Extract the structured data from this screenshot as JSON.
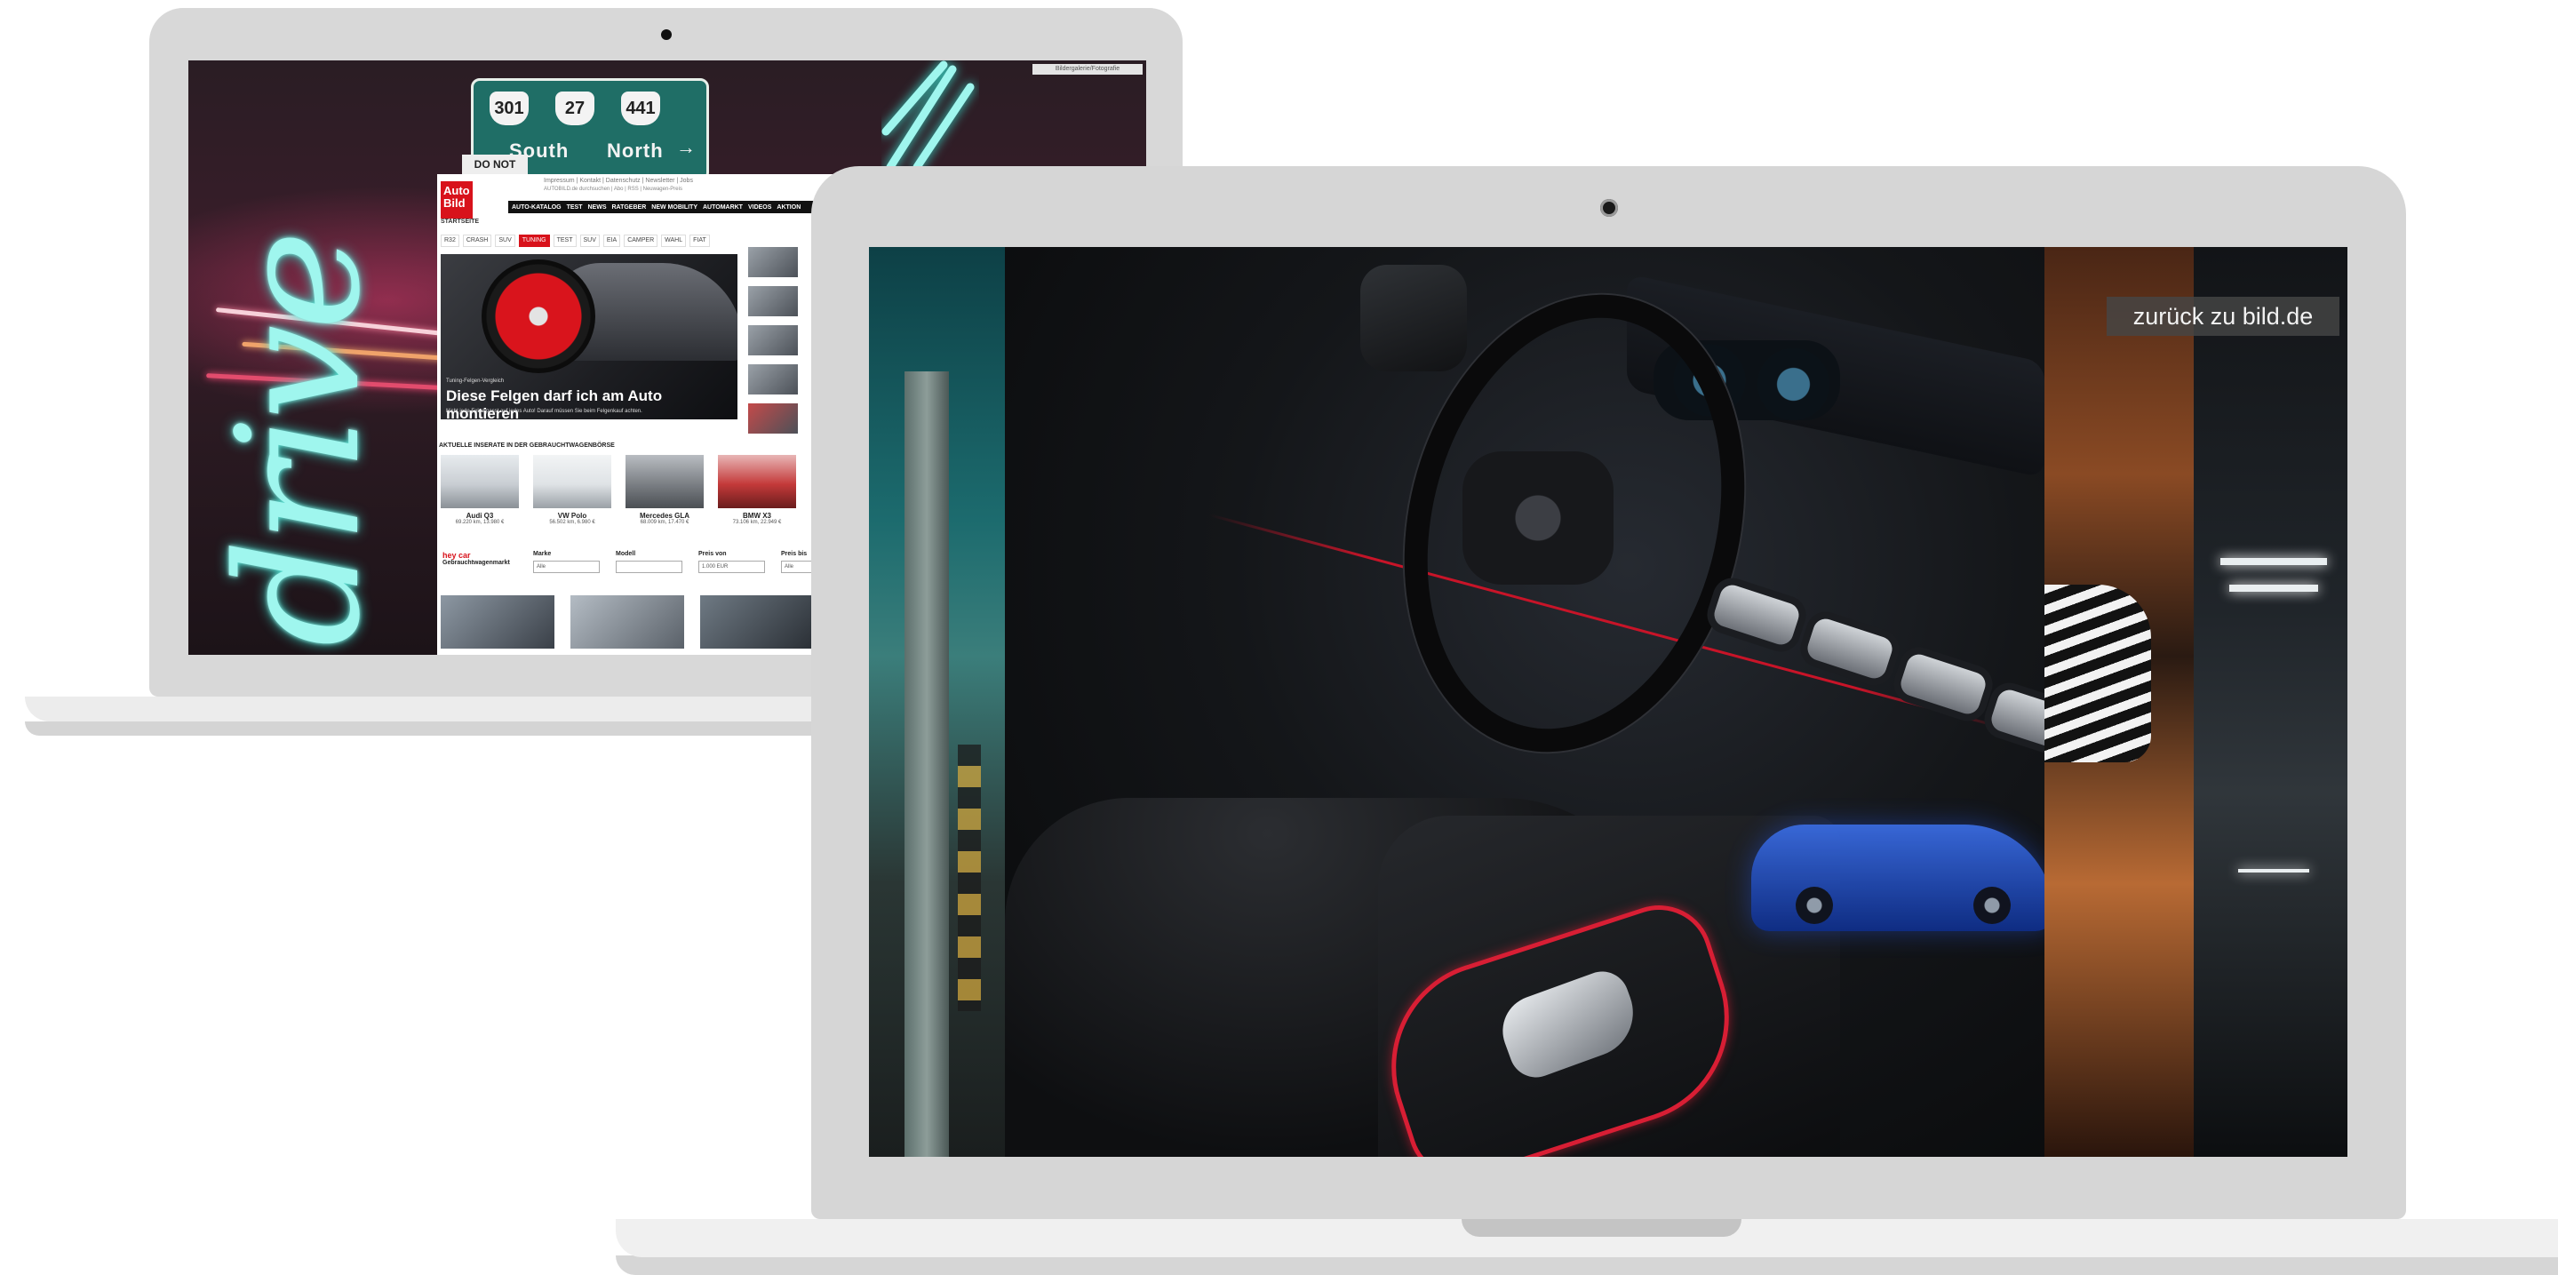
{
  "back_laptop": {
    "scene": {
      "neon_text": "drive",
      "highway_sign": {
        "routes": [
          "301",
          "27",
          "441"
        ],
        "direction_left": "South",
        "direction_right": "North",
        "arrow": "→",
        "extra": "DO NOT"
      },
      "corner_tag": "Bildergalerie/Fotografie"
    },
    "autobild": {
      "logo_line1": "Auto",
      "logo_line2": "Bild",
      "top_links": "Impressum | Kontakt | Datenschutz | Newsletter | Jobs",
      "search_text": "AUTOBILD.de durchsuchen | Abo | RSS | Neuwagen-Preis",
      "nav": [
        "AUTO-KATALOG",
        "TEST",
        "NEWS",
        "RATGEBER",
        "NEW MOBILITY",
        "AUTOMARKT",
        "VIDEOS",
        "AKTION"
      ],
      "breadcrumb": "STARTSEITE",
      "tabs": [
        "R32",
        "CRASH",
        "SUV",
        "TUNING",
        "TEST",
        "SUV",
        "EIA",
        "CAMPER",
        "WAHL",
        "FIAT"
      ],
      "active_tab": "TUNING",
      "hero": {
        "kicker": "Tuning-Felgen-Vergleich",
        "title": "Diese Felgen darf ich am Auto montieren",
        "subtitle": "Nicht jede Felge passt auf jedes Auto! Darauf müssen Sie beim Felgenkauf achten."
      },
      "section_title": "AKTUELLE INSERATE IN DER GEBRAUCHTWAGENBÖRSE",
      "used_cars": [
        {
          "name": "Audi Q3",
          "info": "69.220 km, 13.980 €",
          "color": "#c9ced3"
        },
        {
          "name": "VW Polo",
          "info": "56.502 km, 6.980 €",
          "color": "#dfe3e6"
        },
        {
          "name": "Mercedes GLA",
          "info": "68.009 km, 17.470 €",
          "color": "#7b7f84"
        },
        {
          "name": "BMW X3",
          "info": "73.106 km, 22.949 €",
          "color": "#c43a3a"
        }
      ],
      "hey_car": {
        "logo": "hey car",
        "label": "Gebrauchtwagenmarkt"
      },
      "filters": [
        {
          "label": "Marke",
          "value": "Alle"
        },
        {
          "label": "Modell",
          "value": ""
        },
        {
          "label": "Preis von",
          "value": "1.000 EUR"
        },
        {
          "label": "Preis bis",
          "value": "Alle"
        }
      ]
    }
  },
  "front_laptop": {
    "back_link": {
      "label": "zurück zu bild.de"
    }
  },
  "colors": {
    "laptop_frame": "#d6d6d6",
    "autobild_red": "#d8121b",
    "interior_accent": "#d81e34"
  }
}
